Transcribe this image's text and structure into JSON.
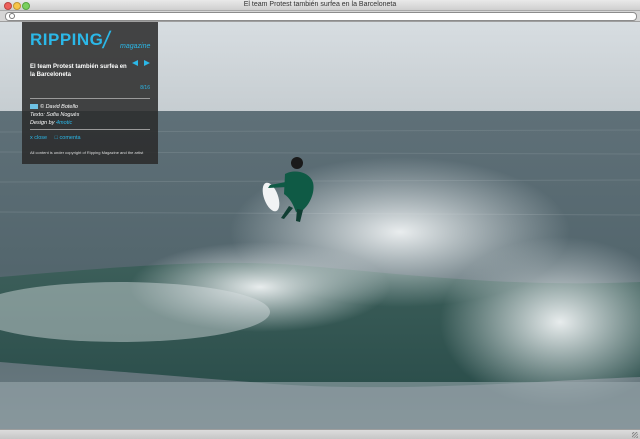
{
  "window": {
    "title": "El team Protest también surfea en la Barceloneta",
    "url": ""
  },
  "panel": {
    "logo_main": "RIPPING",
    "logo_slash": "/",
    "logo_sub": "magazine",
    "post_title": "El team Protest también surfea en la Barceloneta",
    "pager": "8/16",
    "photo_credit": "© David Botello",
    "text_credit": "Texto: Sofia Nogués",
    "design_label": "Design by",
    "design_name": "4motic",
    "close_label": "x close",
    "comment_label": "□ comenta",
    "copyright": "All content is under copyright of Ripping Magazine and the artist"
  },
  "icons": {
    "prev": "arrow-left-icon",
    "next": "arrow-right-icon"
  },
  "colors": {
    "accent": "#2bb8e8",
    "panel_bg": "#2a2a2a"
  }
}
